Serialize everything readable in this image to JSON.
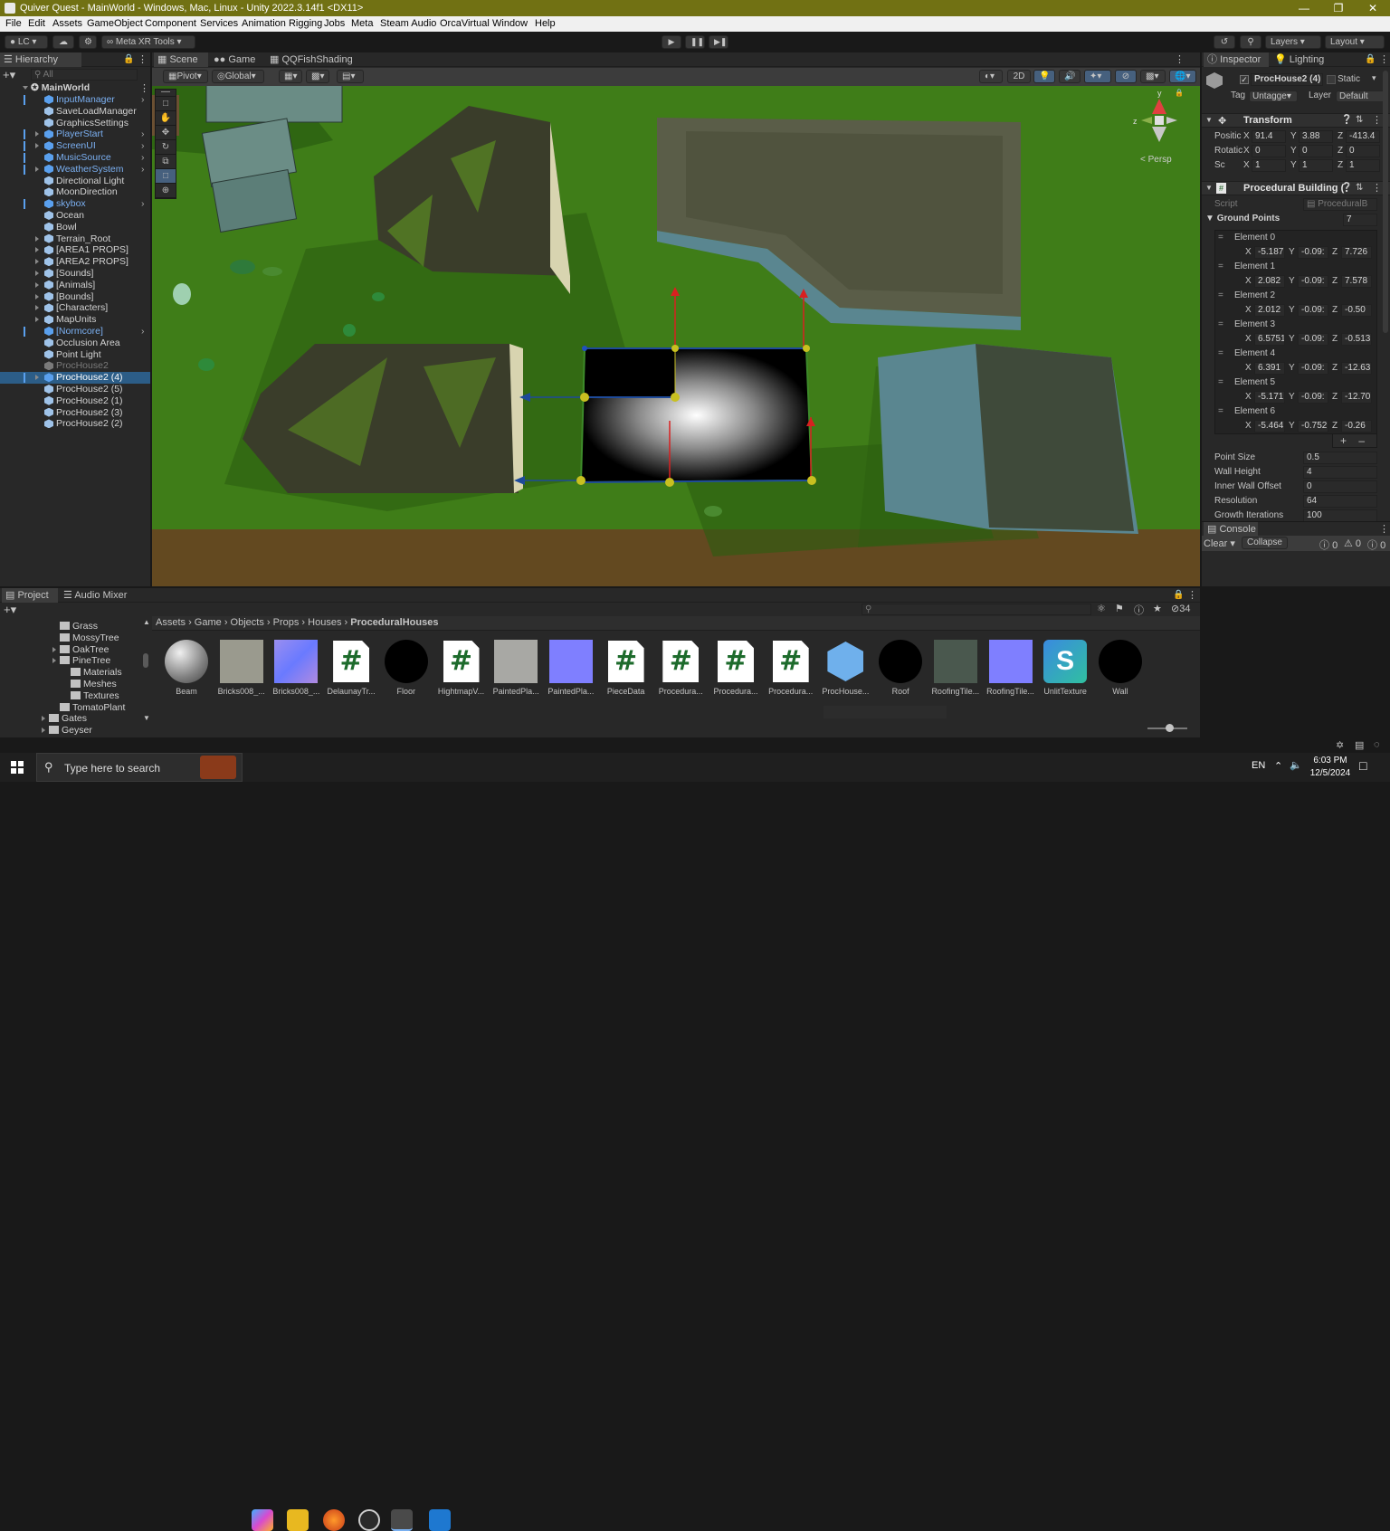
{
  "window": {
    "title": "Quiver Quest - MainWorld - Windows, Mac, Linux - Unity 2022.3.14f1 <DX11>"
  },
  "menu": [
    "File",
    "Edit",
    "Assets",
    "GameObject",
    "Component",
    "Services",
    "Animation Rigging",
    "Jobs",
    "Meta",
    "Steam Audio",
    "OrcaVirtual",
    "Window",
    "Help"
  ],
  "toolbar": {
    "account": "LC",
    "meta_tools": "Meta XR Tools",
    "layers": "Layers",
    "layout": "Layout"
  },
  "hierarchy": {
    "tab": "Hierarchy",
    "search_placeholder": "All",
    "root": "MainWorld",
    "items": [
      {
        "label": "InputManager",
        "style": "blue",
        "arrow": false,
        "expand": true
      },
      {
        "label": "SaveLoadManager",
        "style": "normal",
        "arrow": false,
        "expand": false
      },
      {
        "label": "GraphicsSettings",
        "style": "normal",
        "arrow": false,
        "expand": false
      },
      {
        "label": "PlayerStart",
        "style": "blue",
        "arrow": true,
        "expand": true
      },
      {
        "label": "ScreenUI",
        "style": "blue",
        "arrow": true,
        "expand": true
      },
      {
        "label": "MusicSource",
        "style": "blue",
        "arrow": false,
        "expand": true
      },
      {
        "label": "WeatherSystem",
        "style": "blue",
        "arrow": true,
        "expand": true
      },
      {
        "label": "Directional Light",
        "style": "normal",
        "arrow": false,
        "expand": false
      },
      {
        "label": "MoonDirection",
        "style": "normal",
        "arrow": false,
        "expand": false
      },
      {
        "label": "skybox",
        "style": "blue",
        "arrow": false,
        "expand": true
      },
      {
        "label": "Ocean",
        "style": "normal",
        "arrow": false,
        "expand": false
      },
      {
        "label": "Bowl",
        "style": "normal",
        "arrow": false,
        "expand": false
      },
      {
        "label": "Terrain_Root",
        "style": "normal",
        "arrow": true,
        "expand": false
      },
      {
        "label": "[AREA1 PROPS]",
        "style": "normal",
        "arrow": true,
        "expand": false
      },
      {
        "label": "[AREA2 PROPS]",
        "style": "normal",
        "arrow": true,
        "expand": false
      },
      {
        "label": "[Sounds]",
        "style": "normal",
        "arrow": true,
        "expand": false
      },
      {
        "label": "[Animals]",
        "style": "normal",
        "arrow": true,
        "expand": false
      },
      {
        "label": "[Bounds]",
        "style": "normal",
        "arrow": true,
        "expand": false
      },
      {
        "label": "[Characters]",
        "style": "normal",
        "arrow": true,
        "expand": false
      },
      {
        "label": "MapUnits",
        "style": "normal",
        "arrow": true,
        "expand": false
      },
      {
        "label": "[Normcore]",
        "style": "blue",
        "arrow": false,
        "expand": true
      },
      {
        "label": "Occlusion Area",
        "style": "normal",
        "arrow": false,
        "expand": false
      },
      {
        "label": "Point Light",
        "style": "normal",
        "arrow": false,
        "expand": false
      },
      {
        "label": "ProcHouse2",
        "style": "dim",
        "arrow": false,
        "expand": false
      },
      {
        "label": "ProcHouse2 (4)",
        "style": "selected",
        "arrow": true,
        "expand": false
      },
      {
        "label": "ProcHouse2 (5)",
        "style": "normal",
        "arrow": false,
        "expand": false
      },
      {
        "label": "ProcHouse2 (1)",
        "style": "normal",
        "arrow": false,
        "expand": false
      },
      {
        "label": "ProcHouse2 (3)",
        "style": "normal",
        "arrow": false,
        "expand": false
      },
      {
        "label": "ProcHouse2 (2)",
        "style": "normal",
        "arrow": false,
        "expand": false
      }
    ]
  },
  "scene": {
    "tabs": [
      "Scene",
      "Game",
      "QQFishShading"
    ],
    "pivot": "Pivot",
    "global": "Global",
    "mode2d": "2D",
    "persp": "< Persp"
  },
  "inspector": {
    "tabs": [
      "Inspector",
      "Lighting"
    ],
    "object_name": "ProcHouse2 (4)",
    "static_label": "Static",
    "tag_label": "Tag",
    "tag_value": "Untagge",
    "layer_label": "Layer",
    "layer_value": "Default",
    "transform": {
      "title": "Transform",
      "position": {
        "label": "Positic",
        "x": "91.4",
        "y": "3.88",
        "z": "-413.4"
      },
      "rotation": {
        "label": "Rotatic",
        "x": "0",
        "y": "0",
        "z": "0"
      },
      "scale": {
        "label": "Sc",
        "x": "1",
        "y": "1",
        "z": "1"
      }
    },
    "procedural": {
      "title": "Procedural Building (",
      "script_label": "Script",
      "script_value": "ProceduralB",
      "ground_points_label": "Ground Points",
      "ground_points_count": "7",
      "elements": [
        {
          "name": "Element 0",
          "x": "-5.187",
          "y": "-0.09:",
          "z": "7.726"
        },
        {
          "name": "Element 1",
          "x": "2.082",
          "y": "-0.09:",
          "z": "7.578"
        },
        {
          "name": "Element 2",
          "x": "2.012",
          "y": "-0.09:",
          "z": "-0.50"
        },
        {
          "name": "Element 3",
          "x": "6.5751",
          "y": "-0.09:",
          "z": "-0.513"
        },
        {
          "name": "Element 4",
          "x": "6.391",
          "y": "-0.09:",
          "z": "-12.63"
        },
        {
          "name": "Element 5",
          "x": "-5.171",
          "y": "-0.09:",
          "z": "-12.70"
        },
        {
          "name": "Element 6",
          "x": "-5.464",
          "y": "-0.752",
          "z": "-0.26"
        }
      ],
      "props": [
        {
          "label": "Point Size",
          "value": "0.5"
        },
        {
          "label": "Wall Height",
          "value": "4"
        },
        {
          "label": "Inner Wall Offset",
          "value": "0"
        },
        {
          "label": "Resolution",
          "value": "64"
        },
        {
          "label": "Growth Iterations",
          "value": "100"
        }
      ]
    }
  },
  "console": {
    "tab": "Console",
    "clear": "Clear",
    "collapse": "Collapse",
    "counts": [
      "0",
      "0",
      "0"
    ]
  },
  "project": {
    "tabs": [
      "Project",
      "Audio Mixer"
    ],
    "count": "34",
    "breadcrumb": [
      "Assets",
      "Game",
      "Objects",
      "Props",
      "Houses",
      "ProceduralHouses"
    ],
    "tree": [
      {
        "label": "Grass",
        "indent": 0,
        "arrow": false
      },
      {
        "label": "MossyTree",
        "indent": 0,
        "arrow": false
      },
      {
        "label": "OakTree",
        "indent": 0,
        "arrow": true
      },
      {
        "label": "PineTree",
        "indent": 0,
        "arrow": true
      },
      {
        "label": "Materials",
        "indent": 1,
        "arrow": false
      },
      {
        "label": "Meshes",
        "indent": 1,
        "arrow": false
      },
      {
        "label": "Textures",
        "indent": 1,
        "arrow": false
      },
      {
        "label": "TomatoPlant",
        "indent": 0,
        "arrow": false
      },
      {
        "label": "Gates",
        "indent": -1,
        "arrow": true
      },
      {
        "label": "Geyser",
        "indent": -1,
        "arrow": true
      }
    ],
    "assets": [
      {
        "label": "Beam",
        "kind": "sphere"
      },
      {
        "label": "Bricks008_...",
        "kind": "bricks"
      },
      {
        "label": "Bricks008_...",
        "kind": "normal"
      },
      {
        "label": "DelaunayTr...",
        "kind": "script"
      },
      {
        "label": "Floor",
        "kind": "black"
      },
      {
        "label": "HightmapV...",
        "kind": "script"
      },
      {
        "label": "PaintedPla...",
        "kind": "plaster"
      },
      {
        "label": "PaintedPla...",
        "kind": "flatnormal"
      },
      {
        "label": "PieceData",
        "kind": "script"
      },
      {
        "label": "Procedura...",
        "kind": "script"
      },
      {
        "label": "Procedura...",
        "kind": "script"
      },
      {
        "label": "Procedura...",
        "kind": "script"
      },
      {
        "label": "ProcHouse...",
        "kind": "prefab"
      },
      {
        "label": "Roof",
        "kind": "black"
      },
      {
        "label": "RoofingTile...",
        "kind": "roofing"
      },
      {
        "label": "RoofingTile...",
        "kind": "flatnormal"
      },
      {
        "label": "UnlitTexture",
        "kind": "shader"
      },
      {
        "label": "Wall",
        "kind": "black"
      }
    ]
  },
  "taskbar": {
    "search_placeholder": "Type here to search",
    "lang": "EN",
    "time": "6:03 PM",
    "date": "12/5/2024"
  }
}
